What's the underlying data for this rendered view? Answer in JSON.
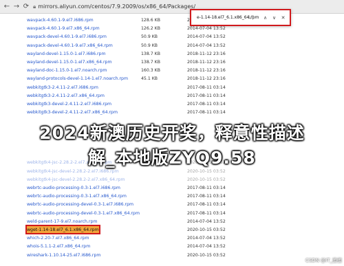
{
  "address_bar": {
    "url": "mirrors.aliyun.com/centos/7.9.2009/os/x86_64/Packages/"
  },
  "find_bar": {
    "query": "e-1.14-18.el7_6.1.x86_64.rpm",
    "count": "1/1"
  },
  "files": [
    {
      "name": "wavpack-4.60.1-9.el7.i686.rpm",
      "size": "128.6 KB",
      "date": "2014-07-04 13:52"
    },
    {
      "name": "wavpack-4.60.1-9.el7.x86_64.rpm",
      "size": "126.2 KB",
      "date": "2014-07-04 13:52"
    },
    {
      "name": "wavpack-devel-4.60.1-9.el7.i686.rpm",
      "size": "50.9 KB",
      "date": "2014-07-04 13:52"
    },
    {
      "name": "wavpack-devel-4.60.1-9.el7.x86_64.rpm",
      "size": "50.9 KB",
      "date": "2014-07-04 13:52"
    },
    {
      "name": "wayland-devel-1.15.0-1.el7.i686.rpm",
      "size": "138.7 KB",
      "date": "2018-11-12 23:16"
    },
    {
      "name": "wayland-devel-1.15.0-1.el7.x86_64.rpm",
      "size": "138.7 KB",
      "date": "2018-11-12 23:16"
    },
    {
      "name": "wayland-doc-1.15.0-1.el7.noarch.rpm",
      "size": "160.3 KB",
      "date": "2018-11-12 23:16"
    },
    {
      "name": "wayland-protocols-devel-1.14-1.el7.noarch.rpm",
      "size": "45.1 KB",
      "date": "2018-11-12 23:16"
    },
    {
      "name": "webkitgtk3-2.4.11-2.el7.i686.rpm",
      "size": "",
      "date": "2017-08-11 03:14"
    },
    {
      "name": "webkitgtk3-2.4.11-2.el7.x86_64.rpm",
      "size": "",
      "date": "2017-08-11 03:14"
    },
    {
      "name": "webkitgtk3-devel-2.4.11-2.el7.i686.rpm",
      "size": "",
      "date": "2017-08-11 03:14"
    },
    {
      "name": "webkitgtk3-devel-2.4.11-2.el7.x86_64.rpm",
      "size": "",
      "date": "2017-08-11 03:14"
    },
    {
      "name": "",
      "size": "",
      "date": ""
    },
    {
      "name": "",
      "size": "",
      "date": ""
    },
    {
      "name": "",
      "size": "",
      "date": ""
    },
    {
      "name": "",
      "size": "",
      "date": ""
    },
    {
      "name": "",
      "size": "",
      "date": ""
    },
    {
      "name": "webkitgtk4-jsc-2.28.2-2.el7.x86_64.rpm",
      "size": "5.7 MB",
      "date": "2020-10-15 03:52"
    },
    {
      "name": "webkitgtk4-jsc-devel-2.28.2-2.el7.i686.rpm",
      "size": "",
      "date": "2020-10-15 03:52"
    },
    {
      "name": "webkitgtk4-jsc-devel-2.28.2-2.el7.x86_64.rpm",
      "size": "",
      "date": "2020-10-15 03:52"
    },
    {
      "name": "webrtc-audio-processing-0.3-1.el7.i686.rpm",
      "size": "",
      "date": "2017-08-11 03:14"
    },
    {
      "name": "webrtc-audio-processing-0.3-1.el7.x86_64.rpm",
      "size": "",
      "date": "2017-08-11 03:14"
    },
    {
      "name": "webrtc-audio-processing-devel-0.3-1.el7.i686.rpm",
      "size": "",
      "date": "2017-08-11 03:14"
    },
    {
      "name": "webrtc-audio-processing-devel-0.3-1.el7.x86_64.rpm",
      "size": "",
      "date": "2017-08-11 03:14"
    },
    {
      "name": "weld-parent-17-9.el7.noarch.rpm",
      "size": "",
      "date": "2014-07-04 13:52"
    },
    {
      "name": "wget-1.14-18.el7_6.1.x86_64.rpm",
      "size": "",
      "date": "2020-10-15 03:52"
    },
    {
      "name": "which-2.20-7.el7.x86_64.rpm",
      "size": "",
      "date": "2014-07-04 13:52"
    },
    {
      "name": "whois-5.1.1-2.el7.x86_64.rpm",
      "size": "",
      "date": "2014-07-04 13:52"
    },
    {
      "name": "wireshark-1.10.14-25.el7.i686.rpm",
      "size": "",
      "date": "2020-10-15 03:52"
    }
  ],
  "overlay": {
    "headline_line1": "2024新澳历史开奖，释意性描述",
    "headline_line2": "解_本地版ZYQ9.58"
  },
  "watermark": "CSDN @IT_蛋蛋"
}
